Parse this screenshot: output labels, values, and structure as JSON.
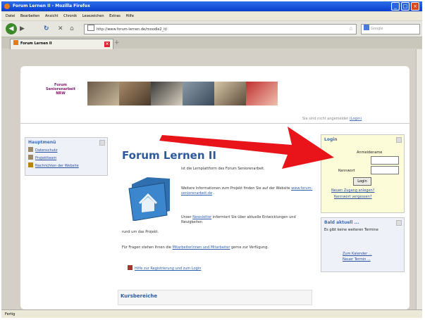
{
  "window": {
    "title": "Forum Lernen II - Mozilla Firefox"
  },
  "menu": [
    "Datei",
    "Bearbeiten",
    "Ansicht",
    "Chronik",
    "Lesezeichen",
    "Extras",
    "Hilfe"
  ],
  "nav": {
    "url": "http://www.forum-lernen.de/moodle2_it/",
    "search_placeholder": "Google"
  },
  "tab": {
    "label": "Forum Lernen II"
  },
  "page": {
    "logo": [
      "Forum",
      "Seniorenarbeit",
      "NRW"
    ],
    "not_logged_in": "Sie sind nicht angemeldet",
    "login_link": "(Login)",
    "main_menu": {
      "title": "Hauptmenü",
      "items": [
        "Datenschutz",
        "Projektteam",
        "Nachrichten der Website"
      ]
    },
    "title": "Forum Lernen II",
    "para1": "ist die Lernplattform des Forum Seniorenarbeit.",
    "para2_text": "Weitere Informationen zum Projekt finden Sie auf der Website",
    "para2_link": "www.forum-seniorenarbeit.de",
    "para3_pre": "Unser",
    "para3_link": "Newsletter",
    "para3_post": "informiert Sie über aktuelle Entwicklungen und Neuigkeiten",
    "para3_cont": "rund um das Projekt.",
    "para4_pre": "Für Fragen stehen Ihnen die",
    "para4_link": "MitarbeiterInnen und Mitarbeiter",
    "para4_post": "gerne zur Verfügung.",
    "help_link": "Hilfe zur Registrierung und zum Login",
    "course_header": "Kursbereiche",
    "login_block": {
      "title": "Login",
      "username_label": "Anmeldename",
      "password_label": "Kennwort",
      "button": "Login",
      "new_account": "Neuen Zugang anlegen?",
      "forgot": "Kennwort vergessen?"
    },
    "upcoming": {
      "title": "Bald aktuell ...",
      "text": "Es gibt keine weiteren Termine",
      "calendar_link": "Zum Kalender ...",
      "new_event_link": "Neuer Termin ..."
    }
  },
  "status": {
    "text": "Fertig"
  },
  "colors": {
    "arrow": "#e8141a",
    "link": "#2a4ea0",
    "title_blue": "#2c5a9c"
  }
}
